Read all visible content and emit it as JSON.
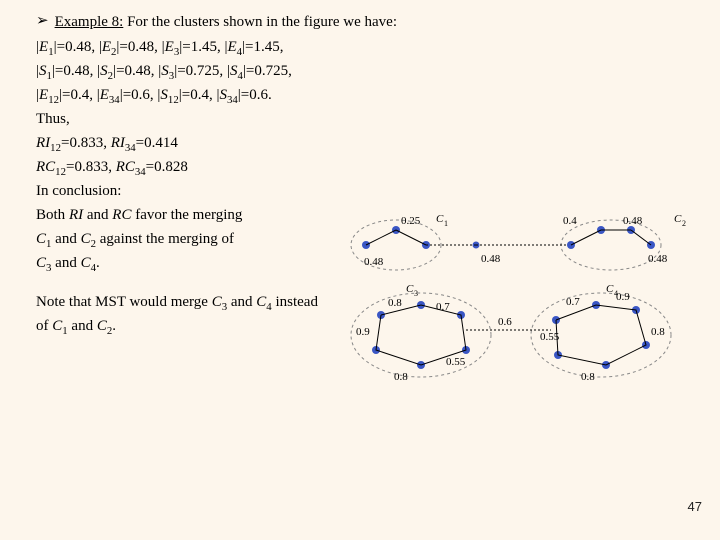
{
  "header": {
    "example_label": "Example 8:",
    "header_rest": " For the clusters shown in the figure we have:"
  },
  "eq": {
    "E1": "0.48",
    "E2": "0.48",
    "E3": "1.45",
    "E4": "1.45",
    "S1": "0.48",
    "S2": "0.48",
    "S3": "0.725",
    "S4": "0.725",
    "E12": "0.4",
    "E34": "0.6",
    "S12": "0.4",
    "S34": "0.6",
    "RI12": "0.833",
    "RI34": "0.414",
    "RC12": "0.833",
    "RC34": "0.828"
  },
  "labels": {
    "thus": "Thus,",
    "in_conclusion": "In conclusion:",
    "both_line_a": "Both ",
    "both_line_b": " and ",
    "both_line_c": " favor the merging",
    "c1c2_line_a": " and ",
    "c1c2_line_b": " against the merging of",
    "c3c4_line_a": " and ",
    "note_a": "Note that MST would merge ",
    "note_b": " and ",
    "note_c": " instead",
    "note2_a": "of ",
    "note2_b": " and ",
    "RI": "RI",
    "RC": "RC",
    "C1": "C",
    "C2": "C",
    "C3": "C",
    "C4": "C"
  },
  "figure": {
    "clusters": {
      "C1": {
        "label": "C₁"
      },
      "C2": {
        "label": "C₂"
      },
      "C3": {
        "label": "C₃"
      },
      "C4": {
        "label": "C₄"
      }
    },
    "edge_labels": {
      "top_left": "0.25",
      "top_middle": "0.4",
      "top_right": "0.48",
      "top_left_side": "0.48",
      "top_right_side": "0.48",
      "between_top": "0.48",
      "c3_tl": "0.8",
      "c3_l": "0.9",
      "c3_b": "0.8",
      "c3_r": "0.7",
      "c3_rr": "0.55",
      "c4_l1": "0.55",
      "c4_tl": "0.7",
      "c4_tr": "0.9",
      "c4_r": "0.8",
      "c4_b": "0.8",
      "between_bottom": "0.6"
    }
  },
  "page_number": "47"
}
